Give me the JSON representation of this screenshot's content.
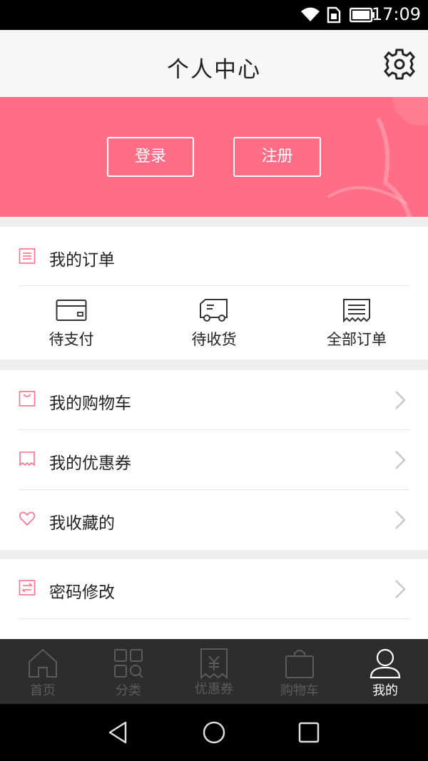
{
  "status": {
    "time": "17:09"
  },
  "header": {
    "title": "个人中心",
    "settings_icon": "gear-icon"
  },
  "banner": {
    "login_label": "登录",
    "register_label": "注册",
    "color": "#ff6e86"
  },
  "orders": {
    "title": "我的订单",
    "tabs": [
      {
        "label": "待支付",
        "icon": "card-icon"
      },
      {
        "label": "待收货",
        "icon": "truck-icon"
      },
      {
        "label": "全部订单",
        "icon": "receipt-icon"
      }
    ]
  },
  "menu": {
    "items": [
      {
        "label": "我的购物车",
        "icon": "cart-icon"
      },
      {
        "label": "我的优惠券",
        "icon": "coupon-icon"
      },
      {
        "label": "我收藏的",
        "icon": "heart-icon"
      },
      {
        "label": "密码修改",
        "icon": "password-icon"
      }
    ]
  },
  "tabbar": {
    "items": [
      {
        "label": "首页",
        "icon": "home-icon",
        "active": false
      },
      {
        "label": "分类",
        "icon": "category-icon",
        "active": false
      },
      {
        "label": "优惠券",
        "icon": "coupon-icon",
        "active": false
      },
      {
        "label": "购物车",
        "icon": "bag-icon",
        "active": false
      },
      {
        "label": "我的",
        "icon": "user-icon",
        "active": true
      }
    ]
  },
  "colors": {
    "accent": "#ff6e86",
    "tabbar_bg": "#2d2d2d"
  }
}
